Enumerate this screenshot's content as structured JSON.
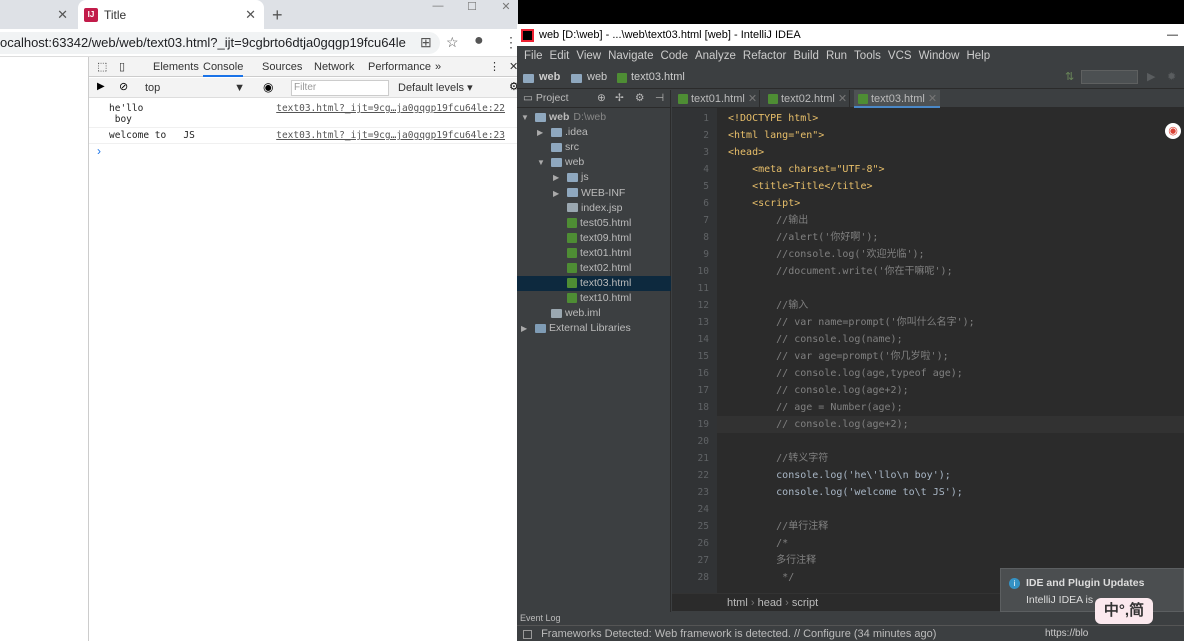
{
  "chrome": {
    "tab_title": "Title",
    "url": "ocalhost:63342/web/web/text03.html?_ijt=9cgbrto6dtja0gqgp19fcu64le",
    "new_tab": "+",
    "win_min": "—",
    "win_max": "☐",
    "win_close": "✕"
  },
  "devtools": {
    "tabs": [
      "Elements",
      "Console",
      "Sources",
      "Network",
      "Performance"
    ],
    "more": "»",
    "context": "top",
    "filter_placeholder": "Filter",
    "levels": "Default levels ▾",
    "logs": [
      {
        "text": "he'llo\n boy",
        "link": "text03.html?_ijt=9cg…ja0gqgp19fcu64le:22"
      },
      {
        "text": "welcome to   JS",
        "link": "text03.html?_ijt=9cg…ja0gqgp19fcu64le:23"
      }
    ],
    "prompt": "›"
  },
  "idea": {
    "title": "web [D:\\web] - ...\\web\\text03.html [web] - IntelliJ IDEA",
    "menu": [
      "File",
      "Edit",
      "View",
      "Navigate",
      "Code",
      "Analyze",
      "Refactor",
      "Build",
      "Run",
      "Tools",
      "VCS",
      "Window",
      "Help"
    ],
    "nav": [
      "web",
      "web",
      "text03.html"
    ],
    "project_label": "Project",
    "tree": [
      {
        "label": "web",
        "extra": "D:\\web",
        "indent": 0,
        "type": "folder",
        "arrow": "▼"
      },
      {
        "label": ".idea",
        "indent": 1,
        "type": "folder",
        "arrow": "▶"
      },
      {
        "label": "src",
        "indent": 1,
        "type": "folder",
        "arrow": ""
      },
      {
        "label": "web",
        "indent": 1,
        "type": "folder",
        "arrow": "▼"
      },
      {
        "label": "js",
        "indent": 2,
        "type": "folder",
        "arrow": "▶"
      },
      {
        "label": "WEB-INF",
        "indent": 2,
        "type": "folder",
        "arrow": "▶"
      },
      {
        "label": "index.jsp",
        "indent": 2,
        "type": "file",
        "arrow": ""
      },
      {
        "label": "test05.html",
        "indent": 2,
        "type": "html",
        "arrow": ""
      },
      {
        "label": "text09.html",
        "indent": 2,
        "type": "html",
        "arrow": ""
      },
      {
        "label": "text01.html",
        "indent": 2,
        "type": "html",
        "arrow": ""
      },
      {
        "label": "text02.html",
        "indent": 2,
        "type": "html",
        "arrow": ""
      },
      {
        "label": "text03.html",
        "indent": 2,
        "type": "html",
        "arrow": "",
        "selected": true
      },
      {
        "label": "text10.html",
        "indent": 2,
        "type": "html",
        "arrow": ""
      },
      {
        "label": "web.iml",
        "indent": 1,
        "type": "file",
        "arrow": ""
      },
      {
        "label": "External Libraries",
        "indent": 0,
        "type": "lib",
        "arrow": "▶"
      }
    ],
    "editor_tabs": [
      "text01.html",
      "text02.html",
      "text03.html"
    ],
    "code": [
      {
        "n": "1",
        "t": "<!DOCTYPE html>",
        "c": "#e8bf6a"
      },
      {
        "n": "2",
        "t": "<html lang=\"en\">",
        "c": "#e8bf6a"
      },
      {
        "n": "3",
        "t": "<head>",
        "c": "#e8bf6a"
      },
      {
        "n": "4",
        "t": "    <meta charset=\"UTF-8\">",
        "c": "#e8bf6a"
      },
      {
        "n": "5",
        "t": "    <title>Title</title>",
        "c": "#e8bf6a"
      },
      {
        "n": "6",
        "t": "    <script>",
        "c": "#e8bf6a"
      },
      {
        "n": "7",
        "t": "        //输出",
        "c": "#808080"
      },
      {
        "n": "8",
        "t": "        //alert('你好啊');",
        "c": "#808080"
      },
      {
        "n": "9",
        "t": "        //console.log('欢迎光临');",
        "c": "#808080"
      },
      {
        "n": "10",
        "t": "        //document.write('你在干嘛呢');",
        "c": "#808080"
      },
      {
        "n": "11",
        "t": "",
        "c": "#a9b7c6"
      },
      {
        "n": "12",
        "t": "        //输入",
        "c": "#808080"
      },
      {
        "n": "13",
        "t": "        // var name=prompt('你叫什么名字');",
        "c": "#808080"
      },
      {
        "n": "14",
        "t": "        // console.log(name);",
        "c": "#808080"
      },
      {
        "n": "15",
        "t": "        // var age=prompt('你几岁啦');",
        "c": "#808080"
      },
      {
        "n": "16",
        "t": "        // console.log(age,typeof age);",
        "c": "#808080"
      },
      {
        "n": "17",
        "t": "        // console.log(age+2);",
        "c": "#808080"
      },
      {
        "n": "18",
        "t": "        // age = Number(age);",
        "c": "#808080"
      },
      {
        "n": "19",
        "t": "        // console.log(age+2);",
        "c": "#808080"
      },
      {
        "n": "20",
        "t": "",
        "c": "#a9b7c6"
      },
      {
        "n": "21",
        "t": "        //转义字符",
        "c": "#808080"
      },
      {
        "n": "22",
        "t": "        console.log('he\\'llo\\n boy');",
        "c": "#a9b7c6"
      },
      {
        "n": "23",
        "t": "        console.log('welcome to\\t JS');",
        "c": "#a9b7c6"
      },
      {
        "n": "24",
        "t": "",
        "c": "#a9b7c6"
      },
      {
        "n": "25",
        "t": "        //单行注释",
        "c": "#808080"
      },
      {
        "n": "26",
        "t": "        /*",
        "c": "#808080"
      },
      {
        "n": "27",
        "t": "        多行注释",
        "c": "#808080"
      },
      {
        "n": "28",
        "t": "         */",
        "c": "#808080"
      }
    ],
    "breadcrumbs": [
      "html",
      "head",
      "script"
    ],
    "event_log": "Event Log",
    "status": "Frameworks Detected: Web framework is detected. // Configure (34 minutes ago)",
    "notification_title": "IDE and Plugin Updates",
    "notification_body": "IntelliJ IDEA is",
    "watermark": "https://blo",
    "ime": "中°,简"
  }
}
